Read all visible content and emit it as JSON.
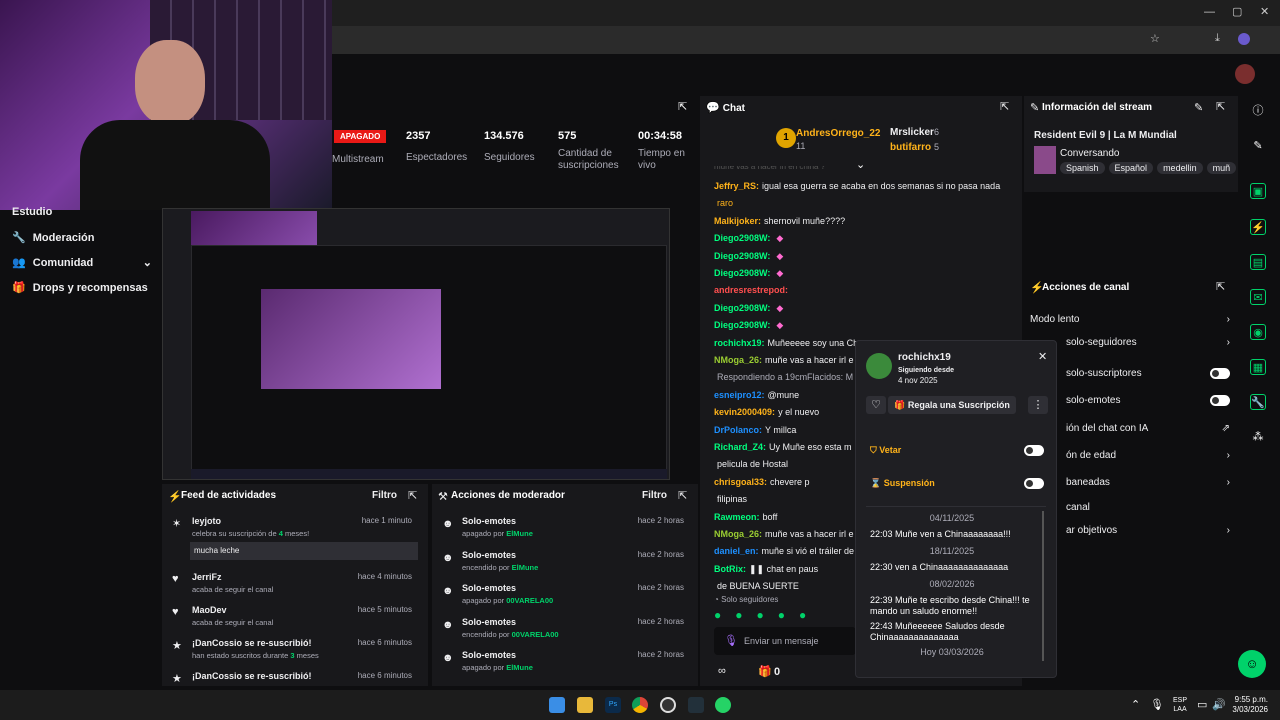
{
  "sidebar": {
    "items": [
      {
        "label": "Estudio"
      },
      {
        "label": "Moderación"
      },
      {
        "label": "Comunidad"
      },
      {
        "label": "Drops y recompensas"
      }
    ]
  },
  "stats": {
    "status": "APAGADO",
    "multistream": "Multistream",
    "viewers": "2357",
    "viewers_lbl": "Espectadores",
    "followers": "134.576",
    "followers_lbl": "Seguidores",
    "subs": "575",
    "subs_lbl": "Cantidad de suscripciones",
    "time": "00:34:58",
    "time_lbl": "Tiempo en vivo"
  },
  "chat": {
    "title": "Chat",
    "top": [
      {
        "name": "AndresOrrego_22",
        "count": "11"
      },
      {
        "name": "Mrslicker",
        "count": "6"
      },
      {
        "name": "butifarro",
        "count": "5"
      }
    ],
    "partial": "muñe vas a hacer irl en china ?",
    "lines": [
      {
        "user": "Jeffry_RS:",
        "msg": "igual esa guerra se acaba en dos semanas si no pasa nada",
        "color": "#ffb31a"
      },
      {
        "user": "",
        "msg": "raro",
        "color": "#ffb31a"
      },
      {
        "user": "Malkijoker:",
        "msg": "shernovil muñe????",
        "color": "#ffb31a"
      },
      {
        "user": "Diego2908W:",
        "msg": "",
        "color": "#00ff7f"
      },
      {
        "user": "Diego2908W:",
        "msg": "",
        "color": "#00ff7f"
      },
      {
        "user": "Diego2908W:",
        "msg": "",
        "color": "#00ff7f"
      },
      {
        "user": "andresrestrepod:",
        "msg": "",
        "color": "#ff4f4f"
      },
      {
        "user": "Diego2908W:",
        "msg": "",
        "color": "#00ff7f"
      },
      {
        "user": "Diego2908W:",
        "msg": "",
        "color": "#00ff7f"
      },
      {
        "user": "rochichx19:",
        "msg": "Muñeeeee soy una Ch",
        "color": "#00ff7f"
      },
      {
        "user": "NMoga_26:",
        "msg": "muñe vas a hacer irl e",
        "color": "#9acd32"
      },
      {
        "user": "",
        "msg": "Respondiendo a 19cmFlacidos: M",
        "color": "#adadb8"
      },
      {
        "user": "esneipro12:",
        "msg": "@mune",
        "color": "#1e90ff"
      },
      {
        "user": "kevin2000409:",
        "msg": "y el nuevo",
        "color": "#ffb31a"
      },
      {
        "user": "DrPolanco:",
        "msg": "Y millca",
        "color": "#1e90ff"
      },
      {
        "user": "Richard_Z4:",
        "msg": "Uy Muñe eso esta m",
        "color": "#00ff7f"
      },
      {
        "user": "",
        "msg": "pelicula de Hostal",
        "color": "#efeff1"
      },
      {
        "user": "chrisgoal33:",
        "msg": "chevere p",
        "color": "#ffb31a"
      },
      {
        "user": "",
        "msg": "filipinas",
        "color": "#efeff1"
      },
      {
        "user": "Rawmeon:",
        "msg": "boff",
        "color": "#00ff7f"
      },
      {
        "user": "NMoga_26:",
        "msg": "muñe vas a hacer irl e",
        "color": "#9acd32"
      },
      {
        "user": "daniel_en:",
        "msg": "muñe si vió el tráiler de",
        "color": "#1e90ff"
      },
      {
        "user": "BotRix:",
        "msg": "❚❚ chat en paus",
        "color": "#00ff7f"
      },
      {
        "user": "",
        "msg": "de BUENA SUERTE",
        "color": "#efeff1"
      }
    ],
    "followers_only": "Solo seguidores",
    "placeholder": "Enviar un mensaje",
    "points": "0"
  },
  "stream_info": {
    "title": "Información del stream",
    "stream_title": "Resident Evil 9 | La M Mundial",
    "category": "Conversando",
    "tags": [
      "Spanish",
      "Español",
      "medellin",
      "muñ"
    ]
  },
  "channel_actions": {
    "title": "Acciones de canal",
    "items": [
      {
        "label": "Modo lento"
      },
      {
        "label": "solo-seguidores"
      },
      {
        "label": "solo-suscriptores"
      },
      {
        "label": "solo-emotes"
      },
      {
        "label": "ión del chat con IA"
      },
      {
        "label": "ón de edad"
      },
      {
        "label": "baneadas"
      },
      {
        "label": "canal"
      },
      {
        "label": "ar objetivos"
      }
    ]
  },
  "usercard": {
    "name": "rochichx19",
    "following_lbl": "Siguiendo desde",
    "following_date": "4 nov 2025",
    "gift": "Regala una Suscripción",
    "ban": "Vetar",
    "suspend": "Suspensión",
    "history": [
      {
        "type": "date",
        "text": "04/11/2025"
      },
      {
        "type": "msg",
        "text": "22:03 Muñe ven a Chinaaaaaaaa!!!"
      },
      {
        "type": "date",
        "text": "18/11/2025"
      },
      {
        "type": "msg",
        "text": "22:30 ven a Chinaaaaaaaaaaaaaa"
      },
      {
        "type": "date",
        "text": "08/02/2026"
      },
      {
        "type": "msg",
        "text": "22:39 Muñe te escribo desde China!!! te mando un saludo enorme!!"
      },
      {
        "type": "msg",
        "text": "22:43 Muñeeeeee Saludos desde Chinaaaaaaaaaaaaaa"
      },
      {
        "type": "date",
        "text": "Hoy 03/03/2026"
      }
    ]
  },
  "feed": {
    "title": "Feed de actividades",
    "filter": "Filtro",
    "rows": [
      {
        "name": "leyjoto",
        "time": "hace 1 minuto",
        "desc_a": "celebra su suscripción de ",
        "desc_hl": "4",
        "desc_b": " meses!",
        "msg": "mucha leche"
      },
      {
        "name": "JerriFz",
        "time": "hace 4 minutos",
        "desc_a": "acaba de seguir el canal",
        "desc_hl": "",
        "desc_b": ""
      },
      {
        "name": "MaoDev",
        "time": "hace 5 minutos",
        "desc_a": "acaba de seguir el canal",
        "desc_hl": "",
        "desc_b": ""
      },
      {
        "name": "¡DanCossio se re-suscribió!",
        "time": "hace 6 minutos",
        "desc_a": "han estado suscritos durante ",
        "desc_hl": "3",
        "desc_b": " meses"
      },
      {
        "name": "¡DanCossio se re-suscribió!",
        "time": "hace 6 minutos",
        "desc_a": "",
        "desc_hl": "",
        "desc_b": ""
      }
    ]
  },
  "modactions": {
    "title": "Acciones de moderador",
    "filter": "Filtro",
    "rows": [
      {
        "action": "Solo-emotes",
        "time": "hace 2 horas",
        "state": "apagado por ",
        "by": "ElMune"
      },
      {
        "action": "Solo-emotes",
        "time": "hace 2 horas",
        "state": "encendido por ",
        "by": "ElMune"
      },
      {
        "action": "Solo-emotes",
        "time": "hace 2 horas",
        "state": "apagado por ",
        "by": "00VARELA00"
      },
      {
        "action": "Solo-emotes",
        "time": "hace 2 horas",
        "state": "encendido por ",
        "by": "00VARELA00"
      },
      {
        "action": "Solo-emotes",
        "time": "hace 2 horas",
        "state": "apagado por ",
        "by": "ElMune"
      }
    ]
  },
  "taskbar": {
    "lang": "ESP",
    "lang2": "LAA",
    "time": "9:55 p.m.",
    "date": "3/03/2026"
  },
  "colors": {
    "accent": "#00d26a",
    "bg": "#0e0e10",
    "panel": "#18181b"
  }
}
